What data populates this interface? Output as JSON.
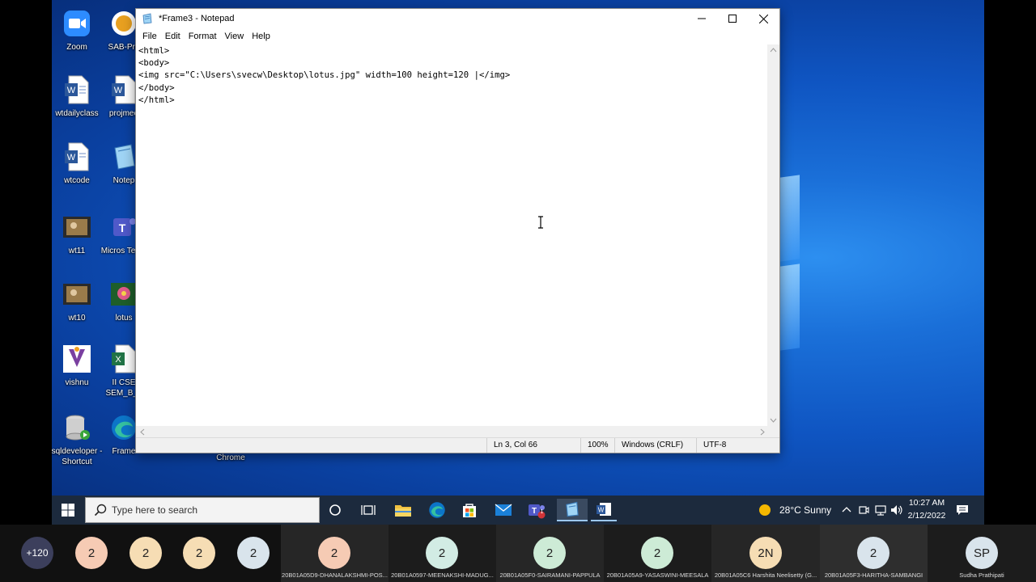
{
  "desktop_icons": [
    {
      "label": "Zoom"
    },
    {
      "label": "SAB-Pro"
    },
    {
      "label": "wtdailyclass"
    },
    {
      "label": "projmee"
    },
    {
      "label": "wtcode"
    },
    {
      "label": "Notep"
    },
    {
      "label": "wt11"
    },
    {
      "label": "Micros Team"
    },
    {
      "label": "wt10"
    },
    {
      "label": "lotus"
    },
    {
      "label": "vishnu"
    },
    {
      "label": "II CSE SEM_B_2"
    },
    {
      "label": "sqldeveloper - Shortcut"
    },
    {
      "label": "Frame"
    },
    {
      "label": "Chrome"
    }
  ],
  "notepad": {
    "title": "*Frame3 - Notepad",
    "menu": [
      "File",
      "Edit",
      "Format",
      "View",
      "Help"
    ],
    "content": "<html>\n<body>\n<img src=\"C:\\Users\\svecw\\Desktop\\lotus.jpg\" width=100 height=120 |</img>\n</body>\n</html>",
    "status": {
      "position": "Ln 3, Col 66",
      "zoom": "100%",
      "line_ending": "Windows (CRLF)",
      "encoding": "UTF-8"
    }
  },
  "taskbar": {
    "search_placeholder": "Type here to search",
    "weather": "28°C  Sunny",
    "time": "10:27 AM",
    "date": "2/12/2022",
    "teams_badge": "1"
  },
  "participants": [
    {
      "avatar": "+120",
      "name": "",
      "color": "#3c3f5c"
    },
    {
      "avatar": "2",
      "name": "",
      "color": "#f6cbb4"
    },
    {
      "avatar": "2",
      "name": "",
      "color": "#f6ddb4"
    },
    {
      "avatar": "2",
      "name": "",
      "color": "#f6ddb4"
    },
    {
      "avatar": "2",
      "name": "",
      "color": "#d9e4ec"
    },
    {
      "avatar": "2",
      "name": "20B01A05D9-DHANALAKSHMI-POS...",
      "color": "#f6cbb4"
    },
    {
      "avatar": "2",
      "name": "20B01A0597-MEENAKSHI-MADUG...",
      "color": "#d2ece4"
    },
    {
      "avatar": "2",
      "name": "20B01A05F0-SAIRAMANI-PAPPULA",
      "color": "#cdebd6"
    },
    {
      "avatar": "2",
      "name": "20B01A05A9-YASASWINI-MEESALA",
      "color": "#cdebd6"
    },
    {
      "avatar": "2N",
      "name": "20B01A05C6 Harshita Neelisetty (G...",
      "color": "#f6ddb4"
    },
    {
      "avatar": "2",
      "name": "20B01A05F3-HARITHA-SAMBANGI",
      "color": "#d9e4ec"
    },
    {
      "avatar": "SP",
      "name": "Sudha Prathipati",
      "color": "#d9e4ec"
    }
  ]
}
